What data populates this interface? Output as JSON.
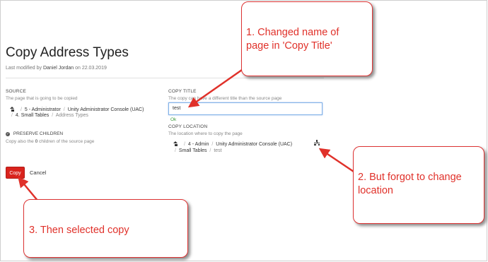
{
  "page": {
    "title": "Copy Address Types",
    "modified_prefix": "Last modified by",
    "modified_by": "Daniel Jordan",
    "modified_on_label": "on 22.03.2019"
  },
  "source": {
    "label": "SOURCE",
    "hint": "The page that is going to be copied",
    "crumbs": [
      "5 - Administrator",
      "Unity Administrator Console (UAC)",
      "4. Small Tables",
      "Address Types"
    ]
  },
  "preserve": {
    "label": "PRESERVE CHILDREN",
    "hint_prefix": "Copy also the",
    "count": "0",
    "hint_suffix": "children of the source page",
    "checked": true
  },
  "copy_title": {
    "label": "COPY TITLE",
    "hint": "The copy can have a different title than the source page",
    "value": "test",
    "status": "Ok"
  },
  "copy_location": {
    "label": "COPY LOCATION",
    "hint": "The location where to copy the page",
    "crumbs": [
      "4 - Admin",
      "Unity Administrator Console (UAC)",
      "Small Tables",
      "test"
    ]
  },
  "actions": {
    "copy_label": "Copy",
    "cancel_label": "Cancel"
  },
  "annotations": {
    "callout1_line1": "1. Changed name of",
    "callout1_line2": "page in 'Copy Title'",
    "callout2_line1": "2. But forgot to change",
    "callout2_line2": "location",
    "callout3": "3. Then selected copy",
    "color": "#e0312a"
  },
  "icons": [
    "home-icon",
    "check-icon",
    "sitemap-icon"
  ]
}
